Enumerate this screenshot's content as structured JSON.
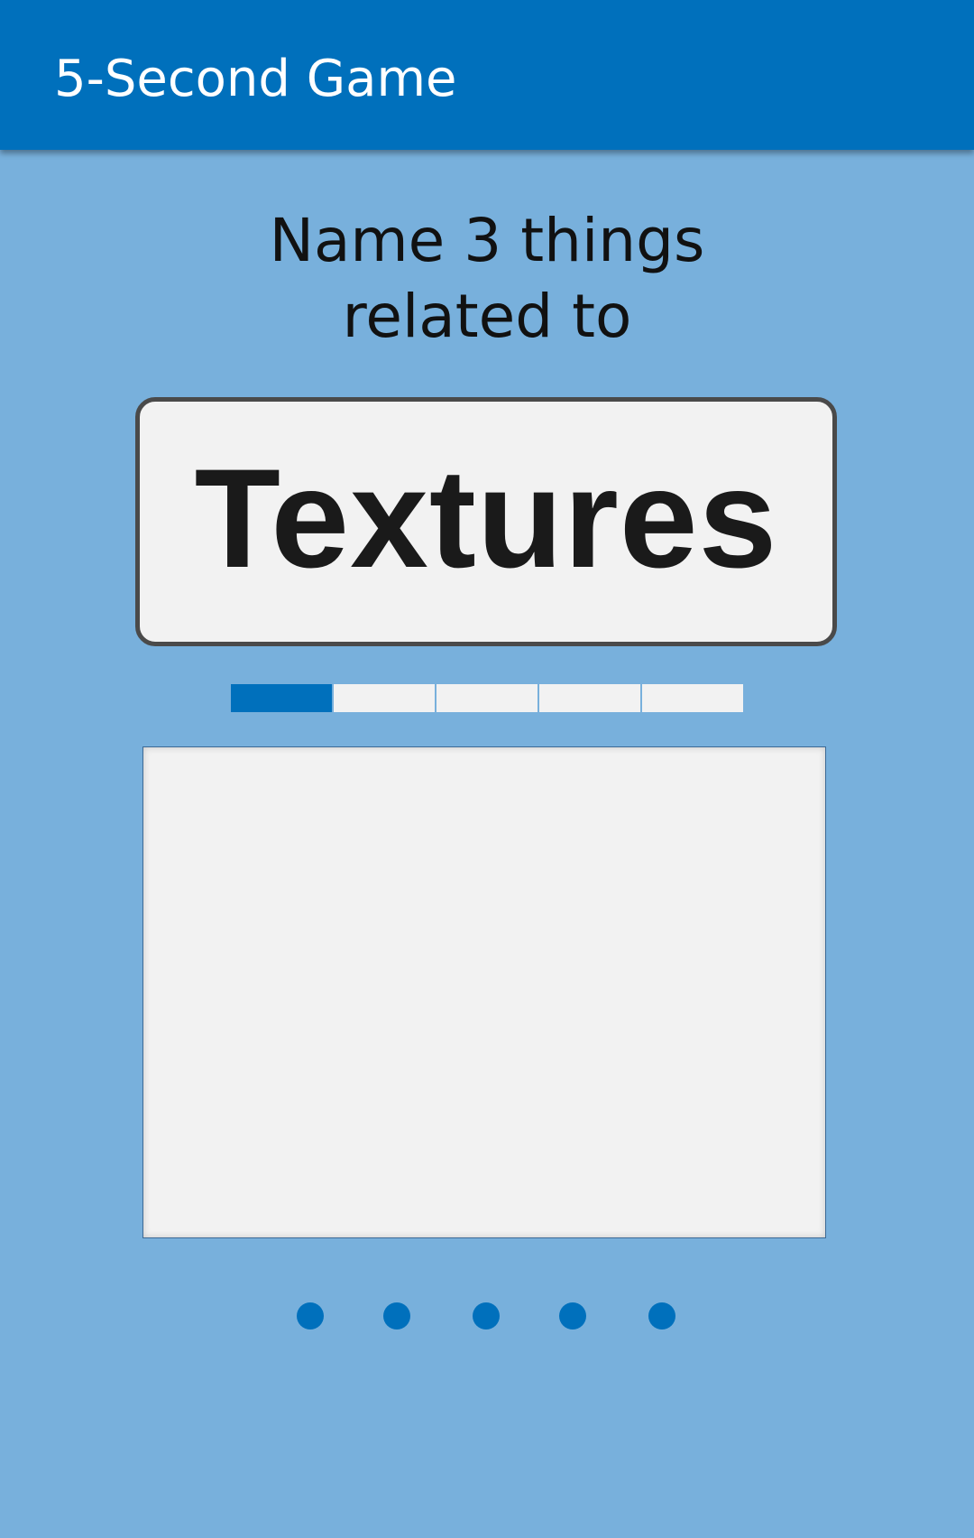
{
  "app_bar": {
    "title": "5-Second Game"
  },
  "prompt": {
    "line1": "Name 3 things",
    "line2": "related to"
  },
  "card": {
    "word": "Textures"
  },
  "timer": {
    "segments_total": 5,
    "segments_filled": 1
  },
  "answer_box": {
    "value": ""
  },
  "pager": {
    "dot_count": 5
  },
  "colors": {
    "accent": "#0070bc",
    "background": "#78b0dc",
    "card": "#f2f2f2"
  }
}
